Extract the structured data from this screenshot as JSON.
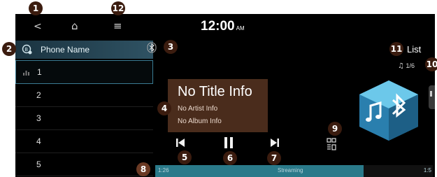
{
  "callouts": [
    "1",
    "2",
    "3",
    "4",
    "5",
    "6",
    "7",
    "8",
    "9",
    "10",
    "11",
    "12"
  ],
  "status": {
    "time": "12:00",
    "ampm": "AM"
  },
  "topbar": {
    "back_glyph": "<",
    "home_glyph": "⌂",
    "menu_glyph": "≡"
  },
  "device": {
    "name": "Phone Name",
    "icon": "phone-settings-icon"
  },
  "bluetooth": {
    "icon": "bluetooth-icon"
  },
  "list": {
    "label": "List",
    "track_counter": "1/6"
  },
  "tracks": [
    "1",
    "2",
    "3",
    "4",
    "5"
  ],
  "info": {
    "title": "No Title Info",
    "artist": "No Artist Info",
    "album": "No Album Info"
  },
  "controls": {
    "prev": "previous-icon",
    "pause": "pause-icon",
    "next": "next-icon"
  },
  "progress": {
    "elapsed": "1:26",
    "total": "1:5",
    "status": "Streaming",
    "fraction": 0.75
  },
  "colors": {
    "callout": "#3b1c0f",
    "accent": "#3a7b93",
    "info_bg": "#4a2c1c",
    "progress_fill": "#2a7a8a"
  }
}
